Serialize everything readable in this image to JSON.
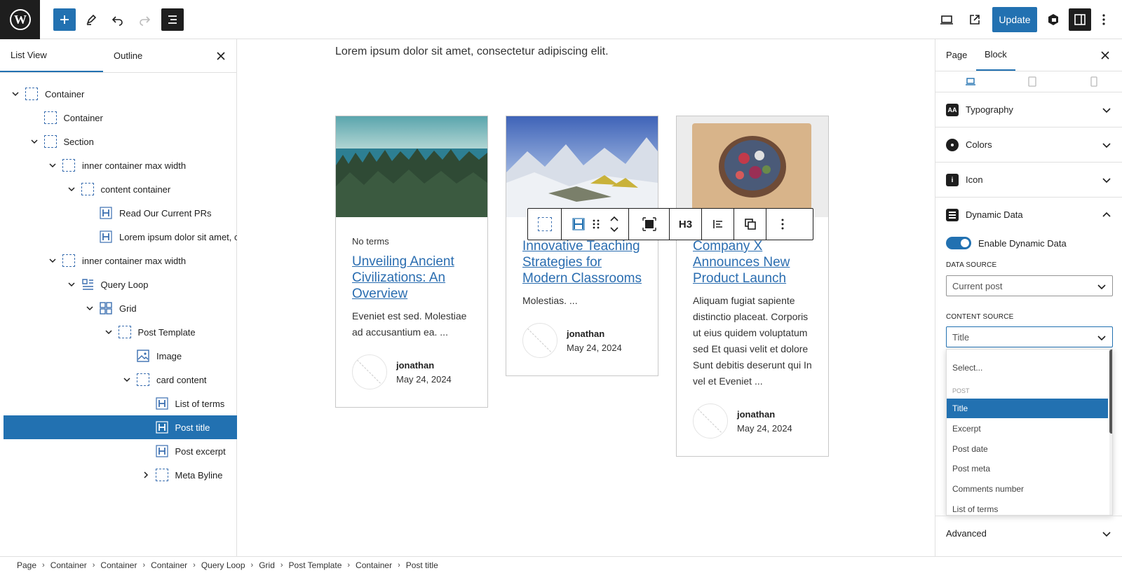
{
  "toolbar": {
    "update_label": "Update"
  },
  "left_panel": {
    "tabs": [
      {
        "label": "List View"
      },
      {
        "label": "Outline"
      }
    ],
    "tree": [
      {
        "label": "Container"
      },
      {
        "label": "Container"
      },
      {
        "label": "Section"
      },
      {
        "label": "inner container max width"
      },
      {
        "label": "content container"
      },
      {
        "label": "Read Our Current PRs"
      },
      {
        "label": "Lorem ipsum dolor sit amet, co"
      },
      {
        "label": "inner container max width"
      },
      {
        "label": "Query Loop"
      },
      {
        "label": "Grid"
      },
      {
        "label": "Post Template"
      },
      {
        "label": "Image"
      },
      {
        "label": "card content"
      },
      {
        "label": "List of terms"
      },
      {
        "label": "Post title"
      },
      {
        "label": "Post excerpt"
      },
      {
        "label": "Meta Byline"
      }
    ]
  },
  "canvas": {
    "intro": "Lorem ipsum dolor sit amet, consectetur adipiscing elit.",
    "cards": [
      {
        "terms": "No terms",
        "title": "Unveiling Ancient Civilizations: An Overview",
        "excerpt": "Eveniet est sed. Molestiae ad accusantium ea. ...",
        "author": "jonathan",
        "date": "May 24, 2024"
      },
      {
        "terms": "",
        "title": "Innovative Teaching Strategies for Modern Classrooms",
        "excerpt": "Molestias. ...",
        "author": "jonathan",
        "date": "May 24, 2024"
      },
      {
        "terms": "",
        "title": "Company X Announces New Product Launch",
        "excerpt": "Aliquam fugiat sapiente distinctio placeat. Corporis ut eius quidem voluptatum sed Et quasi velit et dolore Sunt debitis deserunt qui In vel et Eveniet ...",
        "author": "jonathan",
        "date": "May 24, 2024"
      }
    ],
    "block_toolbar": {
      "heading_level": "H3"
    }
  },
  "right_panel": {
    "tabs": [
      {
        "label": "Page"
      },
      {
        "label": "Block"
      }
    ],
    "sections": [
      {
        "label": "Typography"
      },
      {
        "label": "Colors"
      },
      {
        "label": "Icon"
      },
      {
        "label": "Dynamic Data"
      }
    ],
    "dynamic_data": {
      "toggle_label": "Enable Dynamic Data",
      "toggle_on": true,
      "data_source_label": "DATA SOURCE",
      "data_source_value": "Current post",
      "content_source_label": "CONTENT SOURCE",
      "content_source_value": "Title"
    },
    "dropdown": {
      "placeholder": "Select...",
      "group": "POST",
      "options": [
        "Title",
        "Excerpt",
        "Post date",
        "Post meta",
        "Comments number",
        "List of terms"
      ],
      "selected": "Title"
    },
    "advanced_label": "Advanced"
  },
  "breadcrumb": [
    "Page",
    "Container",
    "Container",
    "Container",
    "Query Loop",
    "Grid",
    "Post Template",
    "Container",
    "Post title"
  ],
  "colors": {
    "accent": "#2271b1",
    "link": "#2a6db0",
    "dark": "#1e1e1e"
  }
}
